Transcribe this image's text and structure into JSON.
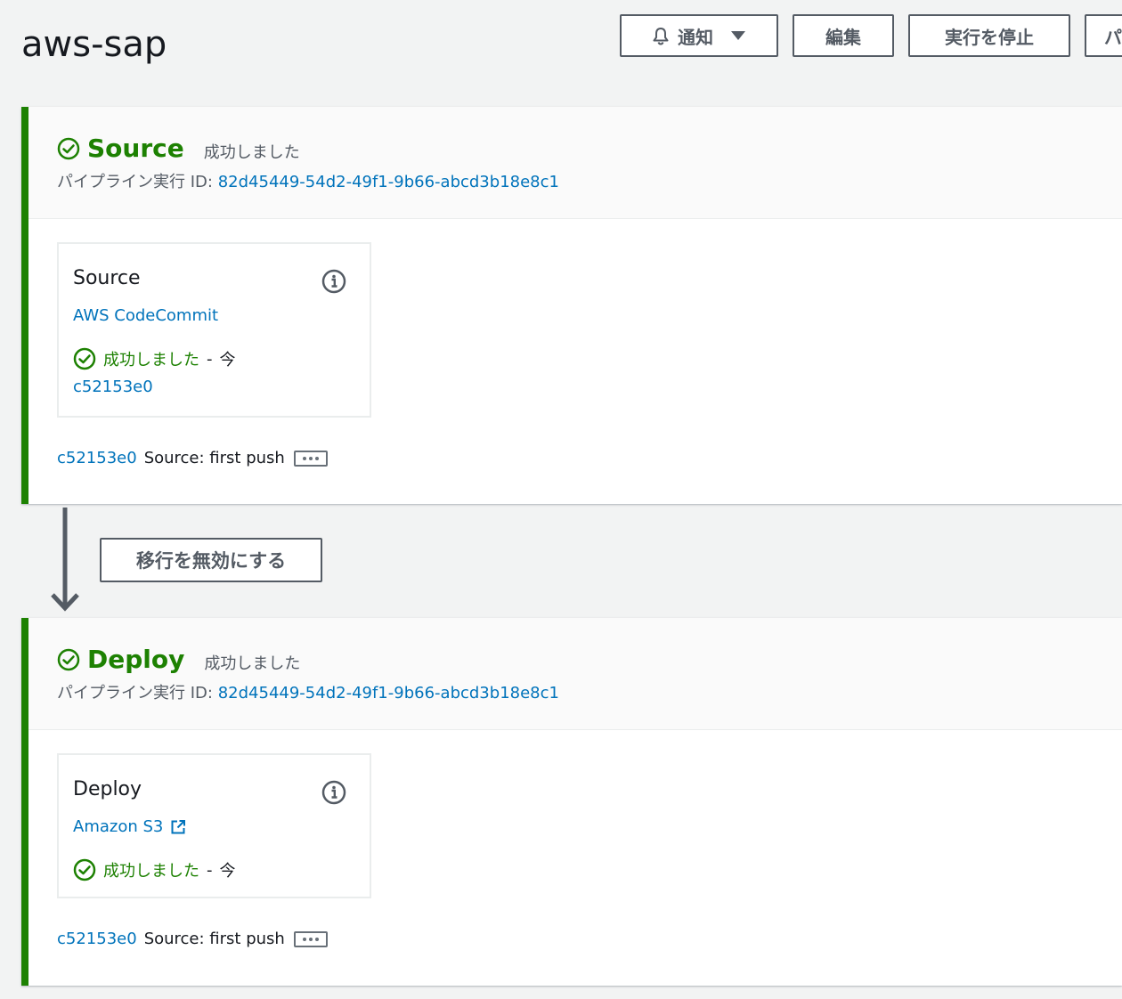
{
  "page": {
    "title": "aws-sap"
  },
  "header_actions": {
    "notify_label": "通知",
    "edit_label": "編集",
    "stop_label": "実行を停止",
    "partial_label": "パ"
  },
  "transition": {
    "disable_label": "移行を無効にする"
  },
  "stages": [
    {
      "name": "Source",
      "status": "成功しました",
      "exec_label": "パイプライン実行 ID:",
      "exec_id": "82d45449-54d2-49f1-9b66-abcd3b18e8c1",
      "action": {
        "name": "Source",
        "provider": "AWS CodeCommit",
        "status": "成功しました",
        "separator": "-",
        "time": "今",
        "revision": "c52153e0"
      },
      "revision": {
        "id": "c52153e0",
        "message": "Source: first push"
      }
    },
    {
      "name": "Deploy",
      "status": "成功しました",
      "exec_label": "パイプライン実行 ID:",
      "exec_id": "82d45449-54d2-49f1-9b66-abcd3b18e8c1",
      "action": {
        "name": "Deploy",
        "provider": "Amazon S3",
        "status": "成功しました",
        "separator": "-",
        "time": "今"
      },
      "revision": {
        "id": "c52153e0",
        "message": "Source: first push"
      }
    }
  ],
  "colors": {
    "success": "#1d8102",
    "link": "#0073bb",
    "button_border": "#545b64",
    "background": "#f2f3f3"
  }
}
